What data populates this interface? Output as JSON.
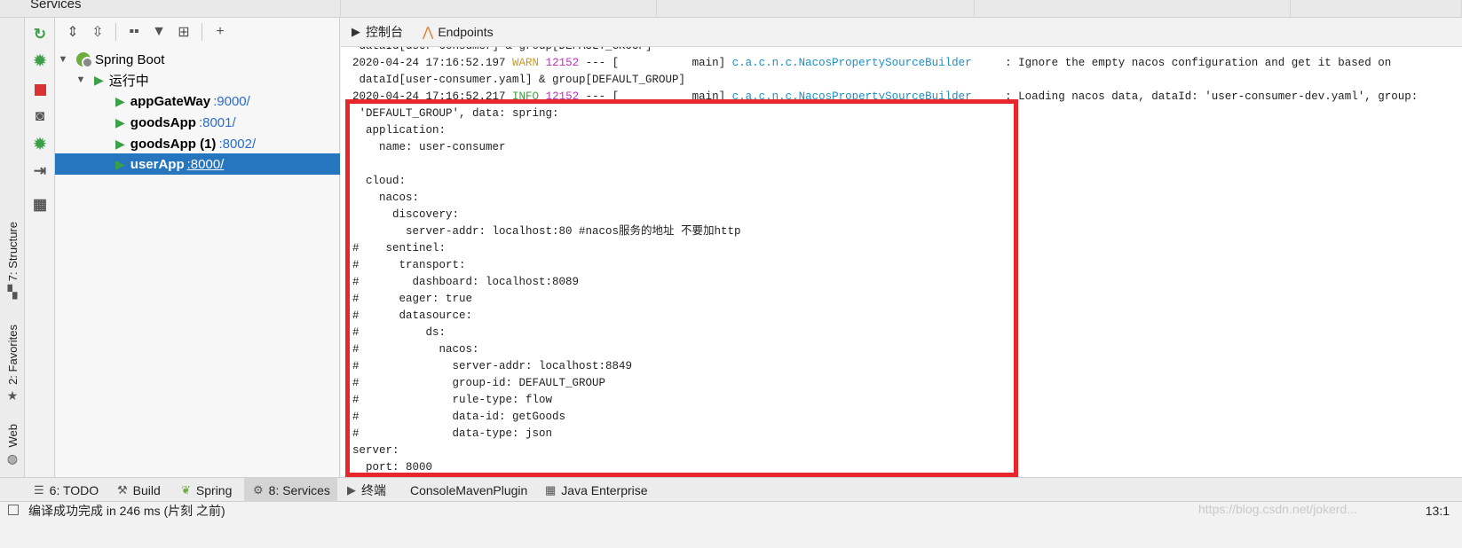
{
  "window": {
    "title": "Services"
  },
  "side_tabs": {
    "structure": "7: Structure",
    "favorites": "2: Favorites",
    "web": "Web"
  },
  "action_bar": {
    "icons": [
      "rerun-icon",
      "debug-icon",
      "stop-icon",
      "camera-icon",
      "debug-attach-icon",
      "import-icon",
      "layout-icon"
    ]
  },
  "tree_toolbar": {
    "icons": [
      "expand-all-icon",
      "collapse-all-icon",
      "group-icon",
      "filter-icon",
      "new-service-icon",
      "add-icon"
    ]
  },
  "tree": {
    "root": {
      "label": "Spring Boot"
    },
    "group": {
      "label": "运行中"
    },
    "apps": [
      {
        "name": "appGateWay",
        "port": ":9000/"
      },
      {
        "name": "goodsApp",
        "port": ":8001/"
      },
      {
        "name": "goodsApp (1)",
        "port": ":8002/"
      },
      {
        "name": "userApp",
        "port": ":8000/"
      }
    ]
  },
  "console": {
    "tabs": [
      {
        "label": "控制台"
      },
      {
        "label": "Endpoints"
      }
    ],
    "lines": {
      "l0": " dataId[user-consumer] & group[DEFAULT_GROUP]",
      "l1_time": "2020-04-24 17:16:52.197",
      "l1_level": "WARN",
      "l1_pid": "12152",
      "l1_mid": " --- [           main] ",
      "l1_logger": "c.a.c.n.c.NacosPropertySourceBuilder",
      "l1_msg": "     : Ignore the empty nacos configuration and get it based on",
      "l2": " dataId[user-consumer.yaml] & group[DEFAULT_GROUP]",
      "l3_time": "2020-04-24 17:16:52.217",
      "l3_level": "INFO",
      "l3_pid": "12152",
      "l3_mid": " --- [           main] ",
      "l3_logger": "c.a.c.n.c.NacosPropertySourceBuilder",
      "l3_msg": "     : Loading nacos data, dataId: 'user-consumer-dev.yaml', group:",
      "l4": " 'DEFAULT_GROUP', data: spring:",
      "l5": "  application:",
      "l6": "    name: user-consumer",
      "l7": "",
      "l8": "  cloud:",
      "l9": "    nacos:",
      "l10": "      discovery:",
      "l11": "        server-addr: localhost:80 #nacos服务的地址 不要加http",
      "l12": "#    sentinel:",
      "l13": "#      transport:",
      "l14": "#        dashboard: localhost:8089",
      "l15": "#      eager: true",
      "l16": "#      datasource:",
      "l17": "#          ds:",
      "l18": "#            nacos:",
      "l19": "#              server-addr: localhost:8849",
      "l20": "#              group-id: DEFAULT_GROUP",
      "l21": "#              rule-type: flow",
      "l22": "#              data-id: getGoods",
      "l23": "#              data-type: json",
      "l24": "server:",
      "l25": "  port: 8000"
    }
  },
  "bottom_tabs": [
    {
      "label": "6: TODO",
      "icon": "list-icon"
    },
    {
      "label": "Build",
      "icon": "hammer-icon"
    },
    {
      "label": "Spring",
      "icon": "spring-icon"
    },
    {
      "label": "8: Services",
      "icon": "services-icon"
    },
    {
      "label": "终端",
      "icon": "terminal-icon"
    },
    {
      "label": "ConsoleMavenPlugin",
      "icon": ""
    },
    {
      "label": "Java Enterprise",
      "icon": "java-enterprise-icon"
    }
  ],
  "status": {
    "message": "编译成功完成 in 246 ms (片刻 之前)",
    "position": "13:1",
    "watermark": "https://blog.csdn.net/jokerd..."
  },
  "colors": {
    "selection": "#2675bf",
    "highlight_border": "#e8262b",
    "warn": "#c89a1e",
    "info": "#3fa13f",
    "logger": "#1c8ec8",
    "pid": "#b832b8"
  }
}
